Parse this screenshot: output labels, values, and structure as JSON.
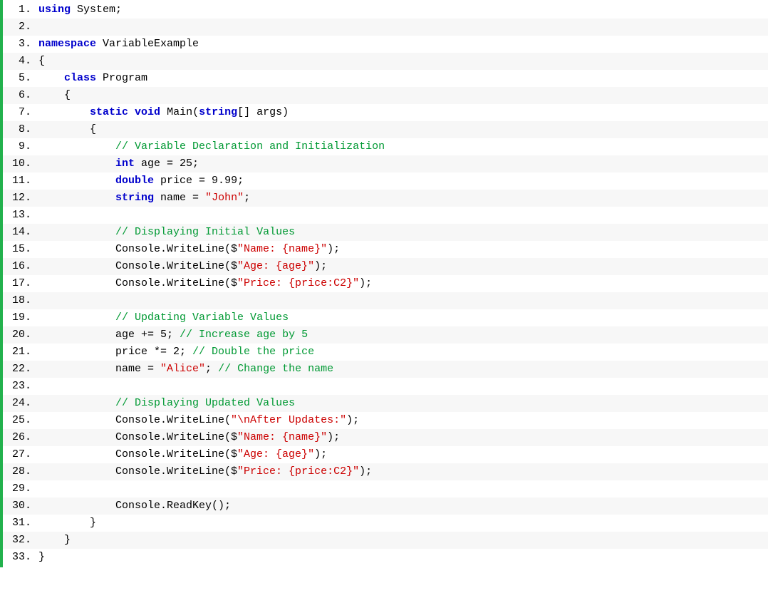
{
  "lines": [
    {
      "n": "1.",
      "tokens": [
        [
          "kw",
          "using"
        ],
        [
          "",
          " System;"
        ]
      ]
    },
    {
      "n": "2.",
      "tokens": []
    },
    {
      "n": "3.",
      "tokens": [
        [
          "kw",
          "namespace"
        ],
        [
          "",
          " VariableExample"
        ]
      ]
    },
    {
      "n": "4.",
      "tokens": [
        [
          "",
          "{"
        ]
      ]
    },
    {
      "n": "5.",
      "tokens": [
        [
          "",
          "    "
        ],
        [
          "kw",
          "class"
        ],
        [
          "",
          " Program"
        ]
      ]
    },
    {
      "n": "6.",
      "tokens": [
        [
          "",
          "    {"
        ]
      ]
    },
    {
      "n": "7.",
      "tokens": [
        [
          "",
          "        "
        ],
        [
          "kw",
          "static"
        ],
        [
          "",
          " "
        ],
        [
          "kw",
          "void"
        ],
        [
          "",
          " Main("
        ],
        [
          "kw",
          "string"
        ],
        [
          "",
          "[] args)"
        ]
      ]
    },
    {
      "n": "8.",
      "tokens": [
        [
          "",
          "        {"
        ]
      ]
    },
    {
      "n": "9.",
      "tokens": [
        [
          "",
          "            "
        ],
        [
          "cm",
          "// Variable Declaration and Initialization"
        ]
      ]
    },
    {
      "n": "10.",
      "tokens": [
        [
          "",
          "            "
        ],
        [
          "kw",
          "int"
        ],
        [
          "",
          " age = 25;"
        ]
      ]
    },
    {
      "n": "11.",
      "tokens": [
        [
          "",
          "            "
        ],
        [
          "kw",
          "double"
        ],
        [
          "",
          " price = 9.99;"
        ]
      ]
    },
    {
      "n": "12.",
      "tokens": [
        [
          "",
          "            "
        ],
        [
          "kw",
          "string"
        ],
        [
          "",
          " name = "
        ],
        [
          "str",
          "\"John\""
        ],
        [
          "",
          ";"
        ]
      ]
    },
    {
      "n": "13.",
      "tokens": []
    },
    {
      "n": "14.",
      "tokens": [
        [
          "",
          "            "
        ],
        [
          "cm",
          "// Displaying Initial Values"
        ]
      ]
    },
    {
      "n": "15.",
      "tokens": [
        [
          "",
          "            Console.WriteLine($"
        ],
        [
          "str",
          "\"Name: {name}\""
        ],
        [
          "",
          ");"
        ]
      ]
    },
    {
      "n": "16.",
      "tokens": [
        [
          "",
          "            Console.WriteLine($"
        ],
        [
          "str",
          "\"Age: {age}\""
        ],
        [
          "",
          ");"
        ]
      ]
    },
    {
      "n": "17.",
      "tokens": [
        [
          "",
          "            Console.WriteLine($"
        ],
        [
          "str",
          "\"Price: {price:C2}\""
        ],
        [
          "",
          ");"
        ]
      ]
    },
    {
      "n": "18.",
      "tokens": []
    },
    {
      "n": "19.",
      "tokens": [
        [
          "",
          "            "
        ],
        [
          "cm",
          "// Updating Variable Values"
        ]
      ]
    },
    {
      "n": "20.",
      "tokens": [
        [
          "",
          "            age += 5; "
        ],
        [
          "cm",
          "// Increase age by 5"
        ]
      ]
    },
    {
      "n": "21.",
      "tokens": [
        [
          "",
          "            price *= 2; "
        ],
        [
          "cm",
          "// Double the price"
        ]
      ]
    },
    {
      "n": "22.",
      "tokens": [
        [
          "",
          "            name = "
        ],
        [
          "str",
          "\"Alice\""
        ],
        [
          "",
          "; "
        ],
        [
          "cm",
          "// Change the name"
        ]
      ]
    },
    {
      "n": "23.",
      "tokens": []
    },
    {
      "n": "24.",
      "tokens": [
        [
          "",
          "            "
        ],
        [
          "cm",
          "// Displaying Updated Values"
        ]
      ]
    },
    {
      "n": "25.",
      "tokens": [
        [
          "",
          "            Console.WriteLine("
        ],
        [
          "str",
          "\"\\nAfter Updates:\""
        ],
        [
          "",
          ");"
        ]
      ]
    },
    {
      "n": "26.",
      "tokens": [
        [
          "",
          "            Console.WriteLine($"
        ],
        [
          "str",
          "\"Name: {name}\""
        ],
        [
          "",
          ");"
        ]
      ]
    },
    {
      "n": "27.",
      "tokens": [
        [
          "",
          "            Console.WriteLine($"
        ],
        [
          "str",
          "\"Age: {age}\""
        ],
        [
          "",
          ");"
        ]
      ]
    },
    {
      "n": "28.",
      "tokens": [
        [
          "",
          "            Console.WriteLine($"
        ],
        [
          "str",
          "\"Price: {price:C2}\""
        ],
        [
          "",
          ");"
        ]
      ]
    },
    {
      "n": "29.",
      "tokens": []
    },
    {
      "n": "30.",
      "tokens": [
        [
          "",
          "            Console.ReadKey();"
        ]
      ]
    },
    {
      "n": "31.",
      "tokens": [
        [
          "",
          "        }"
        ]
      ]
    },
    {
      "n": "32.",
      "tokens": [
        [
          "",
          "    }"
        ]
      ]
    },
    {
      "n": "33.",
      "tokens": [
        [
          "",
          "}"
        ]
      ]
    }
  ]
}
